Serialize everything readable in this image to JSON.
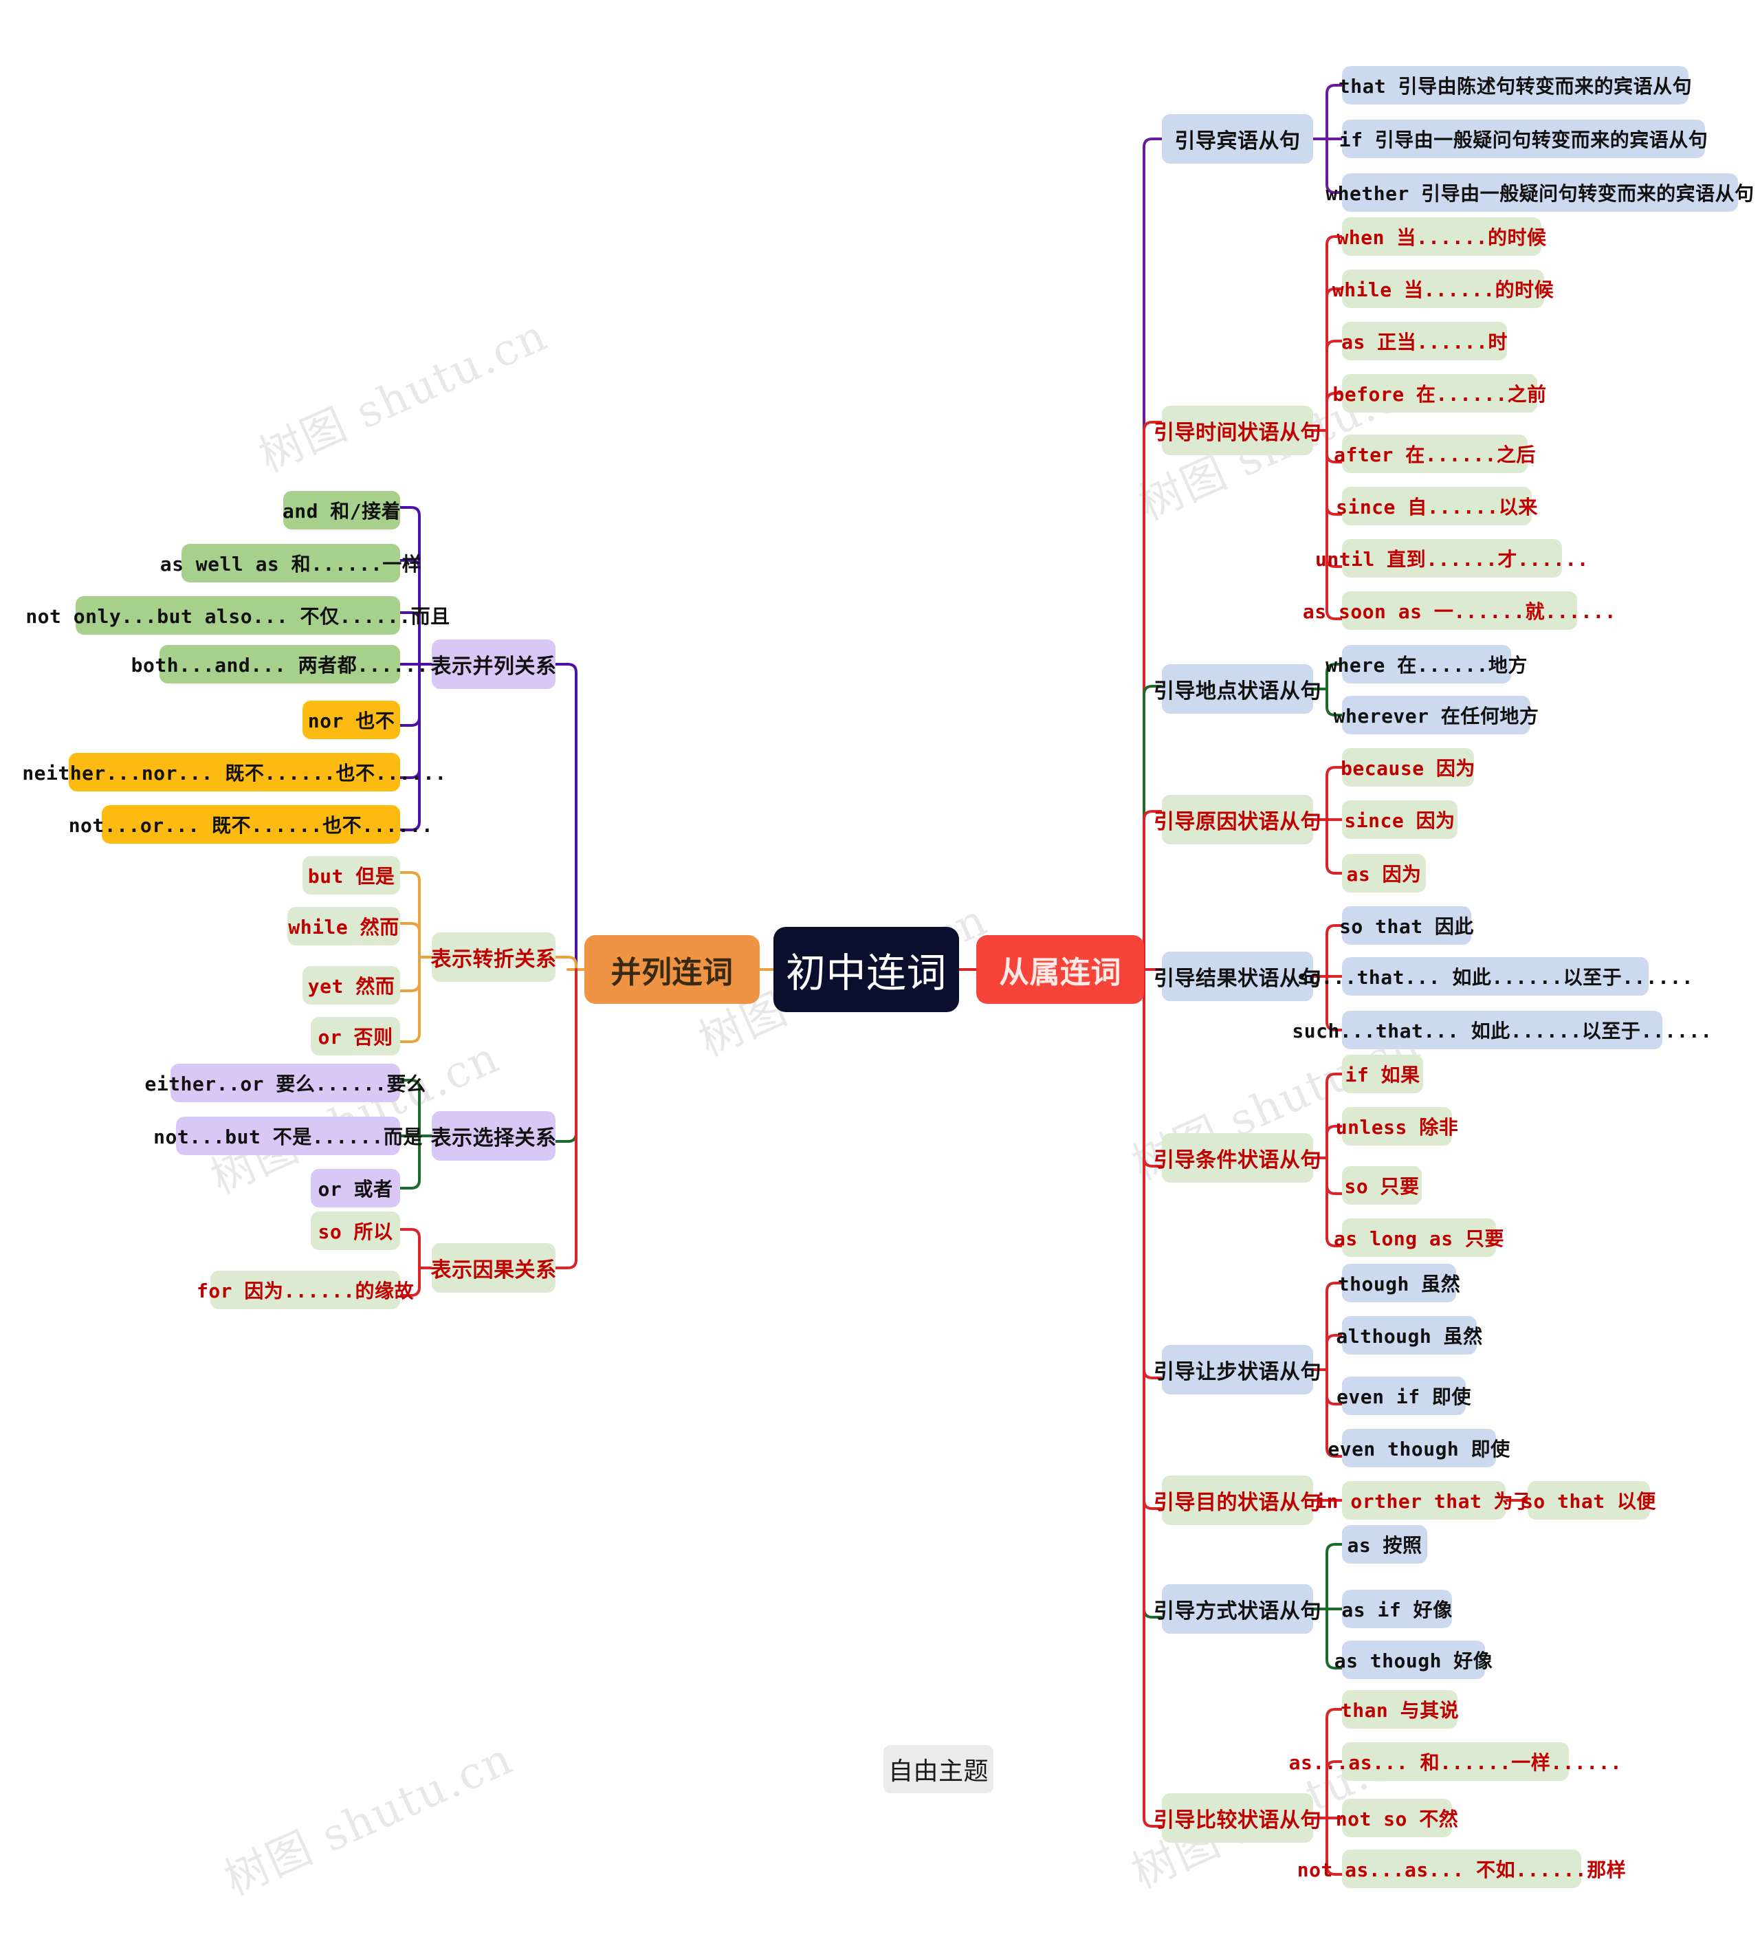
{
  "title": "初中连词",
  "free_topic": {
    "label": "自由主题"
  },
  "watermark": {
    "text": "树图 shutu.cn"
  },
  "branches": {
    "left": {
      "label": "并列连词",
      "groups": [
        {
          "label": "表示并列关系",
          "items": [
            "and 和/接着",
            "as well as 和......一样",
            "not only...but also... 不仅......而且",
            "both...and... 两者都......",
            "nor 也不",
            "neither...nor... 既不......也不......",
            "not...or... 既不......也不......"
          ]
        },
        {
          "label": "表示转折关系",
          "items": [
            "but 但是",
            "while 然而",
            "yet 然而",
            "or 否则"
          ]
        },
        {
          "label": "表示选择关系",
          "items": [
            "either..or 要么......要么",
            "not...but 不是......而是",
            "or 或者"
          ]
        },
        {
          "label": "表示因果关系",
          "items": [
            "so 所以",
            "for 因为......的缘故"
          ]
        }
      ]
    },
    "right": {
      "label": "从属连词",
      "groups": [
        {
          "label": "引导宾语从句",
          "items": [
            "that 引导由陈述句转变而来的宾语从句",
            "if 引导由一般疑问句转变而来的宾语从句",
            "whether 引导由一般疑问句转变而来的宾语从句"
          ]
        },
        {
          "label": "引导时间状语从句",
          "items": [
            "when 当......的时候",
            "while 当......的时候",
            "as 正当......时",
            "before 在......之前",
            "after 在......之后",
            "since 自......以来",
            "until 直到......才......",
            "as soon as 一......就......"
          ]
        },
        {
          "label": "引导地点状语从句",
          "items": [
            "where 在......地方",
            "wherever 在任何地方"
          ]
        },
        {
          "label": "引导原因状语从句",
          "items": [
            "because 因为",
            "since 因为",
            "as 因为"
          ]
        },
        {
          "label": "引导结果状语从句",
          "items": [
            "so that 因此",
            "so...that... 如此......以至于......",
            "such...that... 如此......以至于......"
          ]
        },
        {
          "label": "引导条件状语从句",
          "items": [
            "if 如果",
            "unless 除非",
            "so 只要",
            "as long as 只要"
          ]
        },
        {
          "label": "引导让步状语从句",
          "items": [
            "though 虽然",
            "although 虽然",
            "even if 即使",
            "even though 即使"
          ]
        },
        {
          "label": "引导目的状语从句",
          "items": [
            "in orther that 为了",
            "so that 以便"
          ]
        },
        {
          "label": "引导方式状语从句",
          "items": [
            "as 按照",
            "as if 好像",
            "as though 好像"
          ]
        },
        {
          "label": "引导比较状语从句",
          "items": [
            "than 与其说",
            "as...as... 和......一样......",
            "not so 不然",
            "not as...as... 不如......那样"
          ]
        }
      ]
    }
  },
  "colors": {
    "root_bg": "#0b0f2e",
    "left_bg": "#ef9445",
    "right_bg": "#f7443a",
    "purple_line": "#4b11a8",
    "orange_line": "#e8a33d",
    "green_line": "#1d6b2a",
    "red_line": "#d9252a"
  }
}
